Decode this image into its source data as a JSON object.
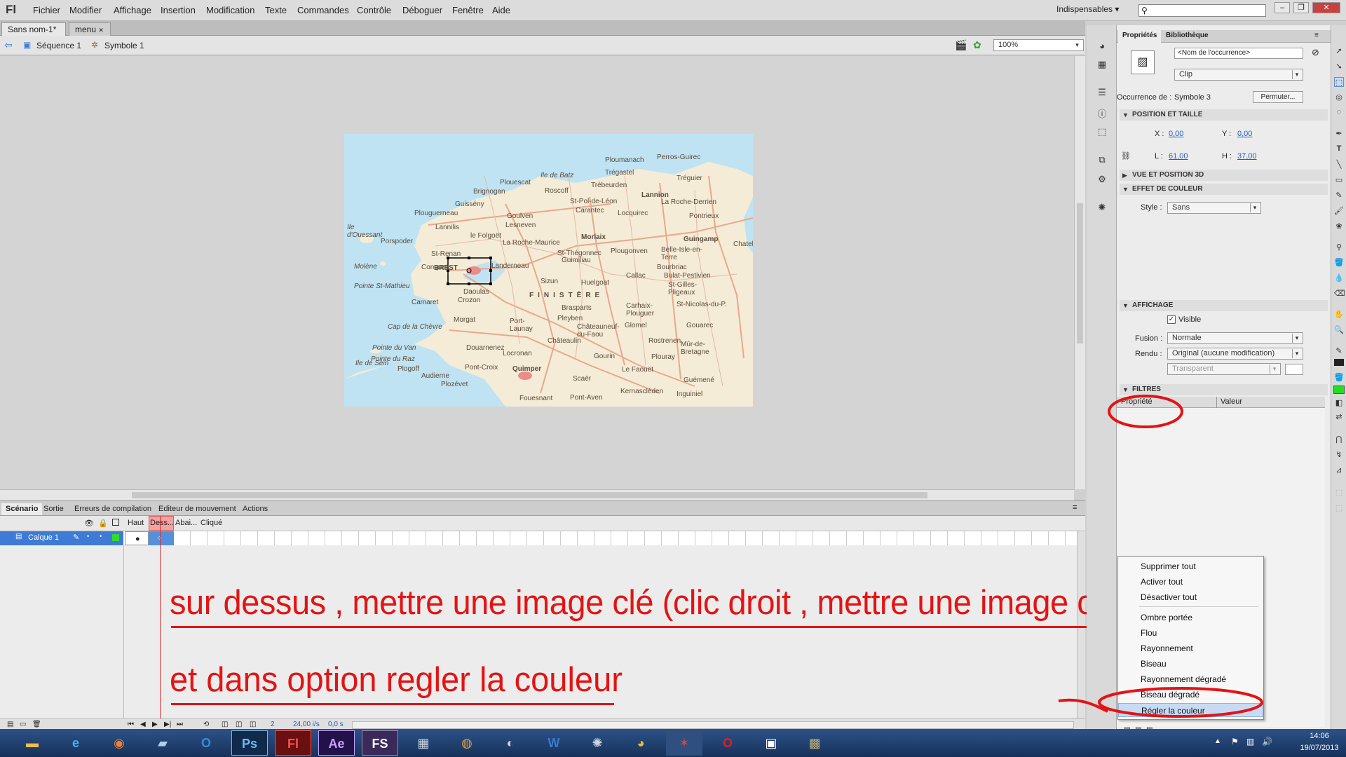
{
  "app": {
    "logo": "Fl"
  },
  "menu": [
    "Fichier",
    "Modifier",
    "Affichage",
    "Insertion",
    "Modification",
    "Texte",
    "Commandes",
    "Contrôle",
    "Déboguer",
    "Fenêtre",
    "Aide"
  ],
  "workspace": "Indispensables",
  "search": {
    "placeholder": ""
  },
  "doc_tabs": [
    {
      "label": "Sans nom-1*"
    },
    {
      "label": "menu"
    }
  ],
  "editbar": {
    "scene": "Séquence 1",
    "symbol": "Symbole 1",
    "zoom": "100%"
  },
  "map": {
    "places": [
      "Ploumanach",
      "Perros-Guirec",
      "Trégastel",
      "Trébeurden",
      "Lannion",
      "Tréguier",
      "Ile de Batz",
      "Roscoff",
      "Plouescat",
      "Brignogan",
      "St-Pol-de-Léon",
      "Carantec",
      "Guissény",
      "Plouguerneau",
      "Lesneven",
      "Locquirec",
      "La Roche-Derrien",
      "Pontrieux",
      "Lannilis",
      "le Folgoët",
      "Goulven",
      "Morlaix",
      "Guingamp",
      "Ile d'Ouessant",
      "Porspoder",
      "St-Renan",
      "La Roche-Maurice",
      "St-Thégonnec",
      "Guimiliau",
      "Plougonven",
      "Belle-Isle-en-Terre",
      "Bourbriac",
      "Landerneau",
      "Conquet",
      "BREST",
      "Daoulas",
      "Sizun",
      "Huelgoat",
      "Callac",
      "Bulat-Pestivien",
      "St-Gilles-Pligeaux",
      "Pointe St-Mathieu",
      "Camaret",
      "Crozon",
      "Molène",
      "FINISTÈRE",
      "Brasparts",
      "Pleyben",
      "Carhaix-Plouguer",
      "St-Nicolas-du-P.",
      "Cap de la Chèvre",
      "Morgat",
      "Port-Launay",
      "Châteaulin",
      "Châteauneuf-du-Faou",
      "Glomel",
      "Gouarec",
      "Pointe du Van",
      "Pointe du Raz",
      "Ile de Sein",
      "Plogoff",
      "Audierne",
      "Plozévet",
      "Douarnenez",
      "Locronan",
      "Pont-Croix",
      "Quimper",
      "Gourin",
      "Le Faouët",
      "Guémené",
      "Mûr-de-Bretagne",
      "Rostrenen",
      "Scaër",
      "Kernascléden",
      "Plouray",
      "Inguiniel",
      "Fouesnant",
      "Pont-Aven",
      "Chatel"
    ],
    "symbol_label": "Symbole"
  },
  "timeline": {
    "tabs": [
      "Scénario",
      "Sortie",
      "Erreurs de compilation",
      "Editeur de mouvement",
      "Actions"
    ],
    "frame_headers": [
      "Haut",
      "Dess...",
      "Abai...",
      "Cliqué"
    ],
    "layer": "Calque 1",
    "status": {
      "frame": "2",
      "fps": "24,00 i/s",
      "time": "0,0 s"
    }
  },
  "panel": {
    "tabs": [
      "Propriétés",
      "Bibliothèque"
    ],
    "instance_name_placeholder": "<Nom de l'occurrence>",
    "type": "Clip",
    "instance_of_label": "Occurrence de :",
    "instance_of": "Symbole 3",
    "swap_button": "Permuter...",
    "sections": {
      "position": "POSITION ET TAILLE",
      "view3d": "VUE ET POSITION 3D",
      "color": "EFFET DE COULEUR",
      "display": "AFFICHAGE",
      "filters": "FILTRES"
    },
    "x_label": "X :",
    "x": "0,00",
    "y_label": "Y :",
    "y": "0,00",
    "w_label": "L :",
    "w": "61,00",
    "h_label": "H :",
    "h": "37,00",
    "style_label": "Style :",
    "style": "Sans",
    "visible_label": "Visible",
    "blend_label": "Fusion :",
    "blend": "Normale",
    "render_label": "Rendu :",
    "render": "Original (aucune modification)",
    "transparent": "Transparent",
    "filter_cols": [
      "Propriété",
      "Valeur"
    ]
  },
  "context_menu": [
    "Supprimer tout",
    "Activer tout",
    "Désactiver tout",
    "Ombre portée",
    "Flou",
    "Rayonnement",
    "Biseau",
    "Rayonnement dégradé",
    "Biseau dégradé",
    "Régler la couleur"
  ],
  "annotation": {
    "line1": "sur dessus , mettre une image clé  (clic droit , mettre une image clé)",
    "line2": "et dans option regler la couleur"
  },
  "taskbar": {
    "apps": [
      "Explorateur",
      "Internet Explorer",
      "Firefox",
      "Notes",
      "Outlook",
      "Ps",
      "Fl",
      "Ae",
      "FS",
      "Calculatrice",
      "Blender",
      "Cinema 4D",
      "W",
      "Logiciel",
      "Chrome",
      "Flash",
      "Opera",
      "Écran",
      "Image"
    ],
    "time": "14:06",
    "date": "19/07/2013"
  },
  "colors": {
    "annotation": "#e31414",
    "accent": "#3d7bd6",
    "highlight": "#c7dcf4"
  }
}
